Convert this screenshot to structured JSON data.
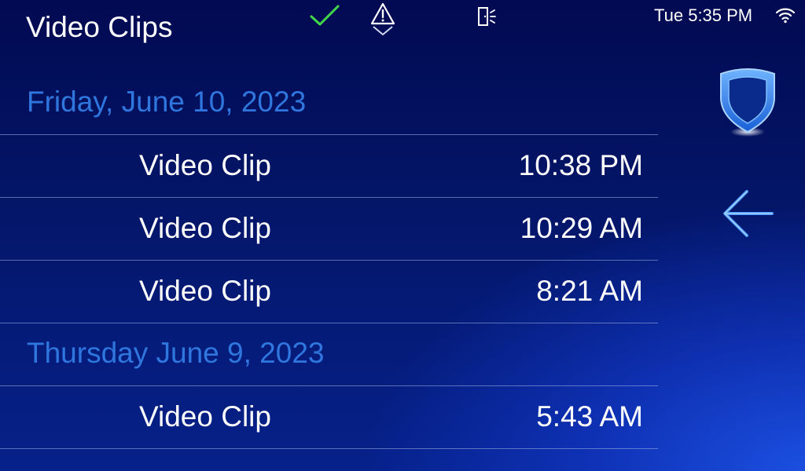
{
  "header": {
    "title": "Video Clips",
    "clock": "Tue 5:35 PM"
  },
  "status_icons": [
    "check-icon",
    "alert-icon",
    "door-icon",
    "wifi-icon"
  ],
  "groups": [
    {
      "date": "Friday, June 10, 2023",
      "clips": [
        {
          "label": "Video Clip",
          "time": "10:38 PM"
        },
        {
          "label": "Video Clip",
          "time": "10:29 AM"
        },
        {
          "label": "Video Clip",
          "time": "8:21 AM"
        }
      ]
    },
    {
      "date": "Thursday June 9, 2023",
      "clips": [
        {
          "label": "Video Clip",
          "time": "5:43 AM"
        }
      ]
    }
  ],
  "side_buttons": [
    "shield-icon",
    "back-arrow-icon"
  ],
  "colors": {
    "accent_date": "#2f76de",
    "check_green": "#3fd94a",
    "background_dark": "#020a52",
    "background_light": "#1b4fe0"
  }
}
